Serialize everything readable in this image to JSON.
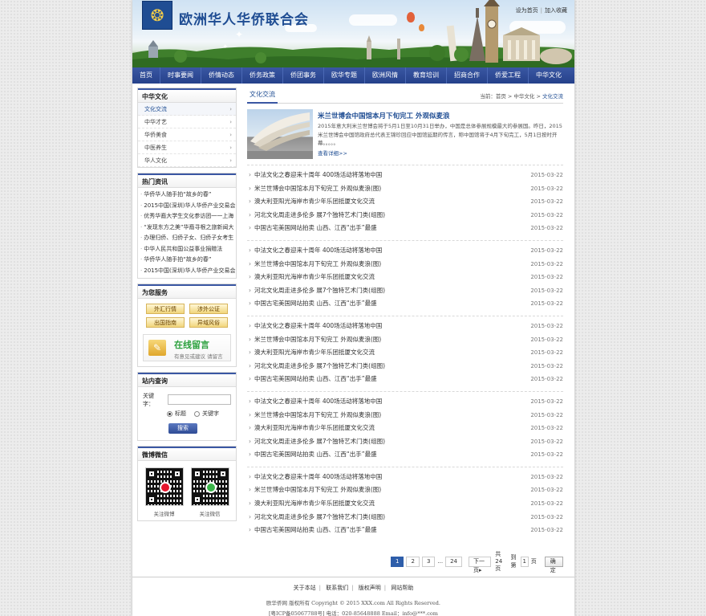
{
  "header": {
    "site_name": "欧洲华人华侨联合会",
    "emblem_glyph": "❂",
    "top_links": [
      "设为首页",
      "加入收藏"
    ]
  },
  "nav": [
    "首页",
    "时事要闻",
    "侨情动态",
    "侨务政策",
    "侨团事务",
    "欧华专题",
    "欧洲风情",
    "教育培训",
    "招商合作",
    "侨爱工程",
    "中华文化"
  ],
  "sidebar": {
    "category_title": "中华文化",
    "categories": [
      "文化交流",
      "中华才艺",
      "华侨美食",
      "中医养生",
      "华人文化"
    ],
    "hot_title": "热门资讯",
    "hot_items": [
      "华侨华人随手拍“故乡的春”",
      "2015中国(深圳)华人华侨产业交易会",
      "优秀华裔大学生文化参访团一一上海",
      "“发现东方之美”华裔寻根之旅新闻大",
      "办理归侨、归侨子女、归侨子女考生",
      "中华人民共和国公益事业捐赠法",
      "华侨华人随手拍“故乡的春”",
      "2015中国(深圳)华人华侨产业交易会"
    ],
    "service_title": "为您服务",
    "services": [
      "外汇行情",
      "涉外公证",
      "出国指南",
      "异域风俗"
    ],
    "message_title": "在线留言",
    "message_sub": "有意见或建议 请留言",
    "search_title": "站内查询",
    "search_label": "关键字：",
    "search_opt1": "标题",
    "search_opt2": "关键字",
    "search_button": "搜索",
    "social_title": "微博微信",
    "qr_weibo": "关注微博",
    "qr_weixin": "关注微信"
  },
  "main": {
    "tab": "文化交流",
    "crumb_prefix": "当前：",
    "crumb_home": "首页",
    "crumb_mid": "中华文化",
    "crumb_cur": "文化交流",
    "feature_title": "米兰世博会中国馆本月下旬完工 外观似麦浪",
    "feature_desc": "2015年意大利米兰世博会将于5月1日至10月31日举办，中国是总体参展规模最大的参展国。昨日，2015米兰世博会中国馆政府总代表王锦珍回应中国馆延期的传言，称中国馆将于4月下旬完工，5月1日按时开幕。。。。。",
    "feature_more": "查看详细>>",
    "news_groups": [
      [
        {
          "t": "中法文化之春迎来十周年 400场活动将落地中国",
          "d": "2015-03-22"
        },
        {
          "t": "米兰世博会中国馆本月下旬完工 外观似麦浪(图)",
          "d": "2015-03-22"
        },
        {
          "t": "澳大利亚阳光海岸市青少年乐团抵厦文化交流",
          "d": "2015-03-22"
        },
        {
          "t": "河北文化周走进多伦多 展7个独特艺术门类(组图)",
          "d": "2015-03-22"
        },
        {
          "t": "中国古宅美国网站拍卖 山西、江西“出手”最盛",
          "d": "2015-03-22"
        }
      ],
      [
        {
          "t": "中法文化之春迎来十周年 400场活动将落地中国",
          "d": "2015-03-22"
        },
        {
          "t": "米兰世博会中国馆本月下旬完工 外观似麦浪(图)",
          "d": "2015-03-22"
        },
        {
          "t": "澳大利亚阳光海岸市青少年乐团抵厦文化交流",
          "d": "2015-03-22"
        },
        {
          "t": "河北文化周走进多伦多 展7个独特艺术门类(组图)",
          "d": "2015-03-22"
        },
        {
          "t": "中国古宅美国网站拍卖 山西、江西“出手”最盛",
          "d": "2015-03-22"
        }
      ],
      [
        {
          "t": "中法文化之春迎来十周年 400场活动将落地中国",
          "d": "2015-03-22"
        },
        {
          "t": "米兰世博会中国馆本月下旬完工 外观似麦浪(图)",
          "d": "2015-03-22"
        },
        {
          "t": "澳大利亚阳光海岸市青少年乐团抵厦文化交流",
          "d": "2015-03-22"
        },
        {
          "t": "河北文化周走进多伦多 展7个独特艺术门类(组图)",
          "d": "2015-03-22"
        },
        {
          "t": "中国古宅美国网站拍卖 山西、江西“出手”最盛",
          "d": "2015-03-22"
        }
      ],
      [
        {
          "t": "中法文化之春迎来十周年 400场活动将落地中国",
          "d": "2015-03-22"
        },
        {
          "t": "米兰世博会中国馆本月下旬完工 外观似麦浪(图)",
          "d": "2015-03-22"
        },
        {
          "t": "澳大利亚阳光海岸市青少年乐团抵厦文化交流",
          "d": "2015-03-22"
        },
        {
          "t": "河北文化周走进多伦多 展7个独特艺术门类(组图)",
          "d": "2015-03-22"
        },
        {
          "t": "中国古宅美国网站拍卖 山西、江西“出手”最盛",
          "d": "2015-03-22"
        }
      ],
      [
        {
          "t": "中法文化之春迎来十周年 400场活动将落地中国",
          "d": "2015-03-22"
        },
        {
          "t": "米兰世博会中国馆本月下旬完工 外观似麦浪(图)",
          "d": "2015-03-22"
        },
        {
          "t": "澳大利亚阳光海岸市青少年乐团抵厦文化交流",
          "d": "2015-03-22"
        },
        {
          "t": "河北文化周走进多伦多 展7个独特艺术门类(组图)",
          "d": "2015-03-22"
        },
        {
          "t": "中国古宅美国网站拍卖 山西、江西“出手”最盛",
          "d": "2015-03-22"
        }
      ]
    ]
  },
  "pager": {
    "pages": [
      "1",
      "2",
      "3"
    ],
    "current": "1",
    "ellipsis": "...",
    "last": "24",
    "next": "下一页▸",
    "total": "共24页",
    "goto": "到第",
    "goto_value": "1",
    "page_unit": "页",
    "ok": "确定"
  },
  "footer": {
    "links": [
      "关于本站",
      "联系我们",
      "版权声明",
      "网站帮助"
    ],
    "copyright": "欧华侨网 版权所有  Copyright © 2015 XXX.com All Rights Reserved.",
    "icp": "[粤ICP备05067788号]  电话：020-85648888  Email：info@***.com"
  },
  "colors": {
    "nav_blue": "#2e4b95",
    "title_blue": "#1f4d93",
    "service_gold": "#f1d57c",
    "message_green": "#2aa03c"
  }
}
